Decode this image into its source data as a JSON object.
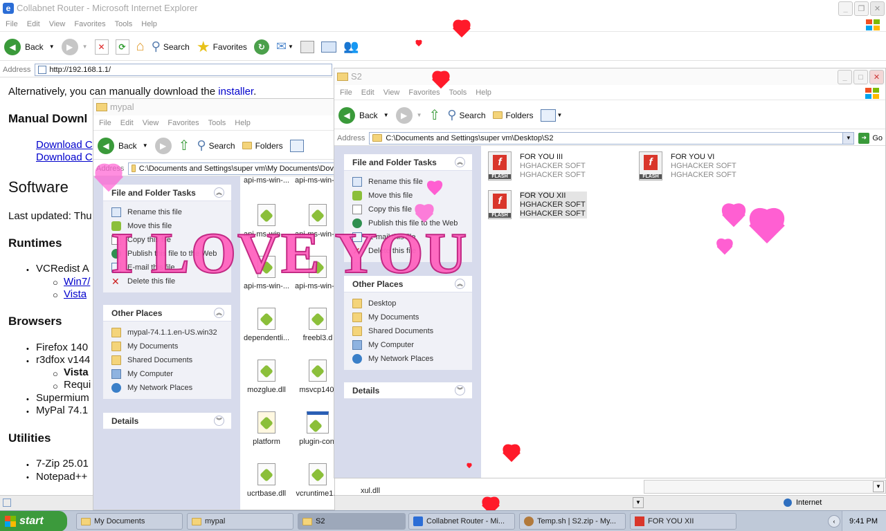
{
  "ie": {
    "title": "Collabnet Router - Microsoft Internet Explorer",
    "menu": [
      "File",
      "Edit",
      "View",
      "Favorites",
      "Tools",
      "Help"
    ],
    "toolbar": {
      "back": "Back",
      "search": "Search",
      "favorites": "Favorites"
    },
    "address_label": "Address",
    "address": "http://192.168.1.1/",
    "content": {
      "alt_text": "Alternatively, you can manually download the",
      "installer_link": "installer",
      "manual_heading": "Manual Downl",
      "download1": "Download C",
      "download2": "Download C",
      "software_heading": "Software",
      "last_updated": "Last updated: Thu",
      "runtimes_heading": "Runtimes",
      "vcredist": "VCRedist A",
      "win7": "Win7/",
      "vista": "Vista",
      "browsers_heading": "Browsers",
      "firefox": "Firefox 140",
      "r3dfox": "r3dfox v144",
      "vista_bold": "Vista",
      "requi": "Requi",
      "supermium": "Supermium",
      "mypal": "MyPal 74.1",
      "utilities_heading": "Utilities",
      "zip": "7-Zip 25.01",
      "notepad": "Notepad++"
    },
    "status_zone": "Internet"
  },
  "mypal": {
    "title": "mypal",
    "menu": [
      "File",
      "Edit",
      "View",
      "Favorites",
      "Tools",
      "Help"
    ],
    "toolbar": {
      "back": "Back",
      "search": "Search",
      "folders": "Folders"
    },
    "address_label": "Address",
    "address": "C:\\Documents and Settings\\super vm\\My Documents\\Dov",
    "tasks_heading": "File and Folder Tasks",
    "tasks": [
      "Rename this file",
      "Move this file",
      "Copy this file",
      "Publish this file to the Web",
      "E-mail this file",
      "Delete this file"
    ],
    "places_heading": "Other Places",
    "places": [
      "mypal-74.1.1.en-US.win32",
      "My Documents",
      "Shared Documents",
      "My Computer",
      "My Network Places"
    ],
    "details_heading": "Details",
    "files": [
      "api-ms-win-...",
      "api-ms-win-...",
      "api-ms-win-...",
      "api-ms-win-...",
      "api-ms-win-...",
      "api-ms-win-...",
      "dependentli...",
      "freebl3.d",
      "mozglue.dll",
      "msvcp140.",
      "platform",
      "plugin-cont",
      "ucrtbase.dll",
      "vcruntime1...",
      "xul.dll"
    ]
  },
  "s2": {
    "title": "S2",
    "menu": [
      "File",
      "Edit",
      "View",
      "Favorites",
      "Tools",
      "Help"
    ],
    "toolbar": {
      "back": "Back",
      "search": "Search",
      "folders": "Folders"
    },
    "address_label": "Address",
    "address": "C:\\Documents and Settings\\super vm\\Desktop\\S2",
    "go": "Go",
    "tasks_heading": "File and Folder Tasks",
    "tasks": [
      "Rename this file",
      "Move this file",
      "Copy this file",
      "Publish this file to the Web",
      "E-mail this file",
      "Delete this file"
    ],
    "places_heading": "Other Places",
    "places": [
      "Desktop",
      "My Documents",
      "Shared Documents",
      "My Computer",
      "My Network Places"
    ],
    "details_heading": "Details",
    "files": [
      {
        "name": "FOR YOU III",
        "line2": "HGHACKER SOFT",
        "line3": "HGHACKER SOFT"
      },
      {
        "name": "FOR YOU VI",
        "line2": "HGHACKER SOFT",
        "line3": "HGHACKER SOFT"
      },
      {
        "name": "FOR YOU XII",
        "line2": "HGHACKER SOFT",
        "line3": "HGHACKER SOFT"
      }
    ],
    "flash_label": "FLASH"
  },
  "overlay_text": "I LOVE YOU",
  "taskbar": {
    "start": "start",
    "tasks": [
      "My Documents",
      "mypal",
      "S2",
      "Collabnet Router - Mi...",
      "Temp.sh | S2.zip - My...",
      "FOR YOU XII"
    ],
    "clock": "9:41 PM"
  },
  "colors": {
    "start_green": "#3c9a3c",
    "heart_red": "#ff1a2a",
    "heart_pink": "#ff5fd2",
    "task_pane": "#d7dbec",
    "link_blue": "#0000cc"
  }
}
